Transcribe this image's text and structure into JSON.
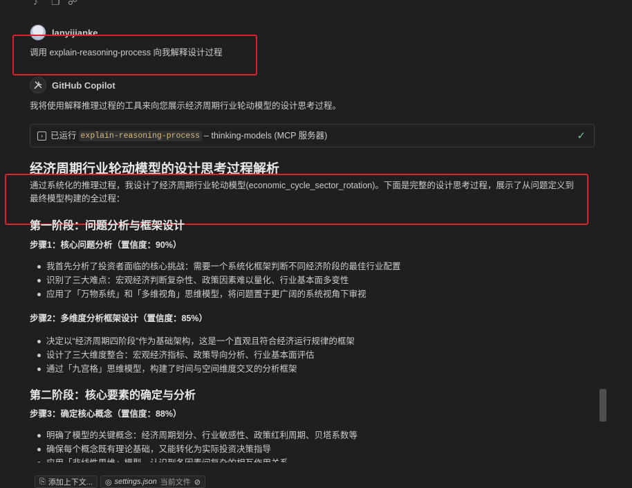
{
  "toolbar": {
    "icons": [
      "speaker-icon",
      "copy-icon",
      "thumb-icon"
    ]
  },
  "user": {
    "name": "lanyijianke",
    "message": "调用 explain-reasoning-process 向我解释设计过程"
  },
  "copilot": {
    "name": "GitHub Copilot",
    "intro": "我将使用解释推理过程的工具来向您展示经济周期行业轮动模型的设计思考过程。",
    "tool_run": {
      "prefix": "已运行",
      "tool_name": "explain-reasoning-process",
      "suffix": "– thinking-models (MCP 服务器)"
    }
  },
  "doc": {
    "title": "经济周期行业轮动模型的设计思考过程解析",
    "intro_line1": "通过系统化的推理过程，我设计了经济周期行业轮动模型(economic_cycle_sector_rotation)。下面是完整的设计思考过程，展示了从问题定义到",
    "intro_line2": "最终模型构建的全过程：",
    "stage1": "第一阶段：问题分析与框架设计",
    "step1": "步骤1：核心问题分析（置信度：90%）",
    "step1_items": [
      "我首先分析了投资者面临的核心挑战：需要一个系统化框架判断不同经济阶段的最佳行业配置",
      "识别了三大难点：宏观经济判断复杂性、政策因素难以量化、行业基本面多变性",
      "应用了「万物系统」和「多维视角」思维模型，将问题置于更广阔的系统视角下审视"
    ],
    "step2": "步骤2：多维度分析框架设计（置信度：85%）",
    "step2_items": [
      "决定以“经济周期四阶段”作为基础架构，这是一个直观且符合经济运行规律的框架",
      "设计了三大维度整合：宏观经济指标、政策导向分析、行业基本面评估",
      "通过「九宫格」思维模型，构建了时间与空间维度交叉的分析框架"
    ],
    "stage2": "第二阶段：核心要素的确定与分析",
    "step3": "步骤3：确定核心概念（置信度：88%）",
    "step3_items": [
      "明确了模型的关键概念：经济周期划分、行业敏感性、政策红利周期、贝塔系数等",
      "确保每个概念既有理论基础，又能转化为实际投资决策指导",
      "应用「非线性思维」模型，认识到各因素间复杂的相互作用关系"
    ]
  },
  "input_bar": {
    "add_context": "添加上下文...",
    "file_chip": "settings.json",
    "file_chip_note": "当前文件"
  }
}
